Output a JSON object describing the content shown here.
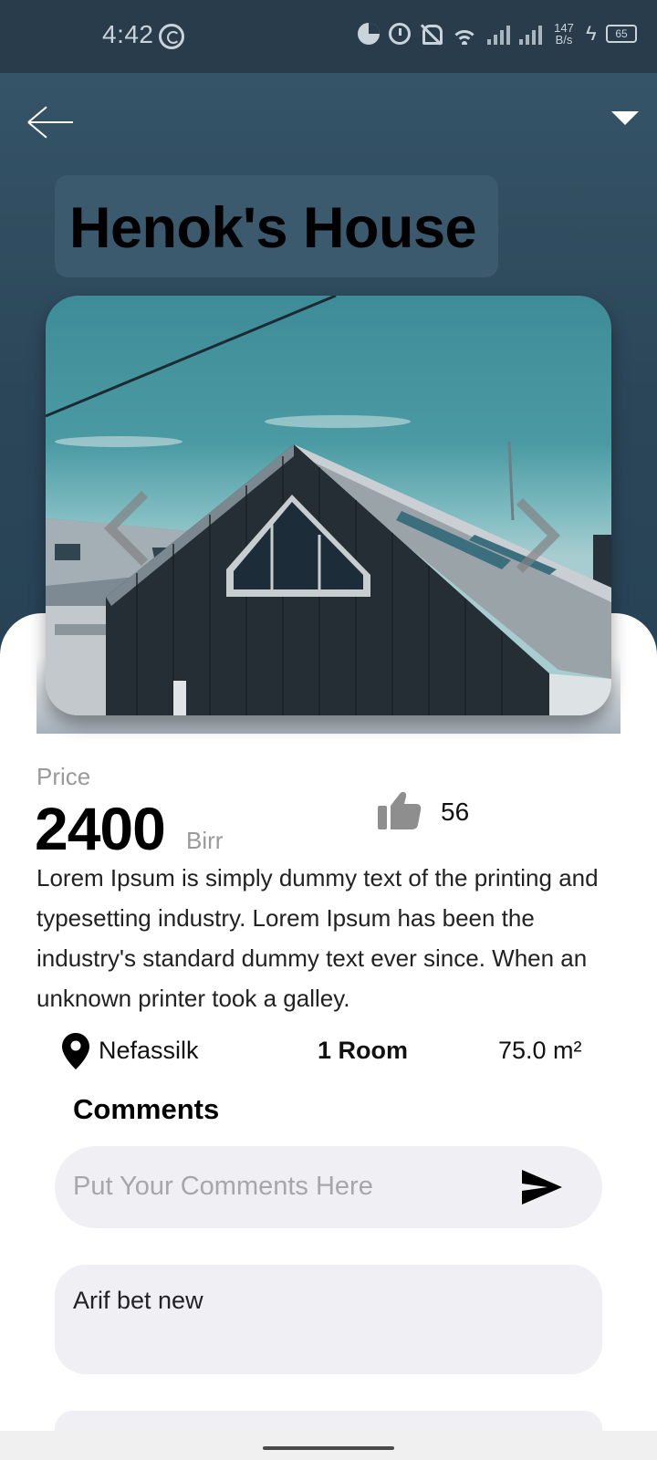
{
  "status_bar": {
    "time": "4:42",
    "net_speed_value": "147",
    "net_speed_unit": "B/s",
    "battery": "65"
  },
  "header": {
    "title": "Henok's House",
    "back_icon": "arrow-left-icon",
    "menu_icon": "caret-down-icon"
  },
  "gallery": {
    "prev_icon": "chevron-left-icon",
    "next_icon": "chevron-right-icon"
  },
  "listing": {
    "price_label": "Price",
    "price": "2400",
    "currency": "Birr",
    "likes": "56",
    "description": "Lorem Ipsum is simply dummy text of the printing and typesetting industry. Lorem Ipsum has been the industry's standard dummy text ever since. When an unknown printer took a galley.",
    "location": "Nefassilk",
    "rooms": "1 Room",
    "area": "75.0 m²"
  },
  "comments": {
    "title": "Comments",
    "placeholder": "Put Your Comments Here",
    "items": [
      {
        "text": "Arif bet new"
      },
      {
        "text": ""
      }
    ]
  },
  "colors": {
    "header_bg": "#2c4659",
    "title_chip": "#3b5a6e",
    "input_bg": "#efeff4"
  }
}
